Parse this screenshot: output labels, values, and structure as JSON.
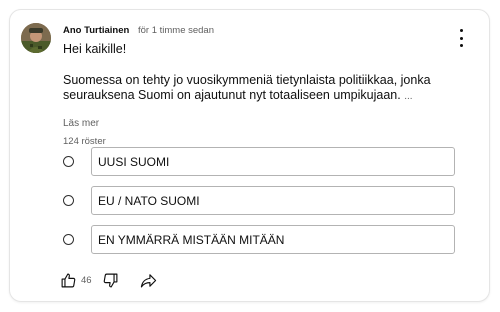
{
  "post": {
    "author": "Ano Turtiainen",
    "time": "för 1 timme sedan",
    "greeting": "Hei kaikille!",
    "paragraph": "Suomessa on tehty jo vuosikymmeniä tietynlaista politiikkaa, jonka seurauksena Suomi on ajautunut nyt totaaliseen umpikujaan.",
    "ellipsis": "...",
    "read_more": "Läs mer",
    "vote_count": "124 röster"
  },
  "poll": {
    "options": [
      {
        "label": "UUSI SUOMI"
      },
      {
        "label": "EU / NATO SUOMI"
      },
      {
        "label": "EN YMMÄRRÄ MISTÄÄN MITÄÄN"
      }
    ]
  },
  "actions": {
    "like_count": "46",
    "icons": [
      "thumbs-up-icon",
      "thumbs-down-icon",
      "share-icon",
      "more-vert-icon"
    ]
  },
  "colors": {
    "text": "#0f0f0f",
    "secondary_text": "#606060",
    "border": "#b3b3b3"
  }
}
